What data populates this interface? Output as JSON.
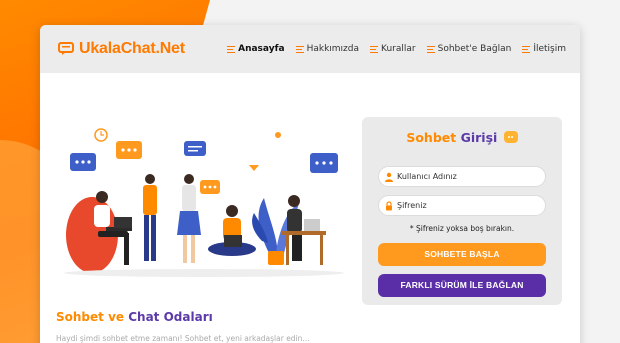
{
  "brand": {
    "name": "UkalaChat.Net",
    "color": "#ff7a00",
    "accent": "#5a2ea6"
  },
  "nav": {
    "items": [
      {
        "label": "Anasayfa",
        "active": true
      },
      {
        "label": "Hakkımızda",
        "active": false
      },
      {
        "label": "Kurallar",
        "active": false
      },
      {
        "label": "Sohbet'e Bağlan",
        "active": false
      },
      {
        "label": "İletişim",
        "active": false
      }
    ]
  },
  "login": {
    "title_part1": "Sohbet",
    "title_part2": "Girişi",
    "username_placeholder": "Kullanıcı Adınız",
    "password_placeholder": "Şifreniz",
    "hint": "* Şifreniz yoksa boş bırakın.",
    "primary_button": "SOHBETE BAŞLA",
    "secondary_button": "FARKLI SÜRÜM İLE BAĞLAN"
  },
  "section": {
    "title_part1": "Sohbet ve",
    "title_part2": "Chat Odaları",
    "intro_text": "Haydi şimdi sohbet etme zamanı! Sohbet et, yeni arkadaşlar edin..."
  }
}
